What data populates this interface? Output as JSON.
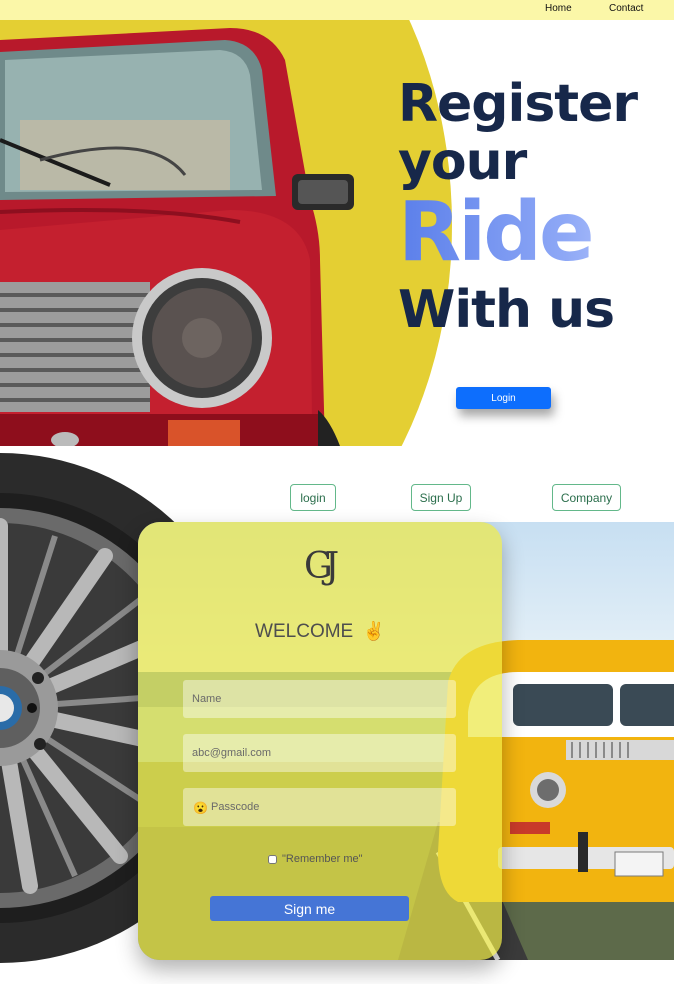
{
  "nav": {
    "home": "Home",
    "contact": "Contact"
  },
  "hero": {
    "line1": "Register",
    "line2": "your",
    "line3": "Ride",
    "line4": "With us",
    "login_button": "Login"
  },
  "tabs": {
    "login": "login",
    "signup": "Sign Up",
    "company": "Company"
  },
  "form": {
    "logo": "GJ",
    "welcome": "WELCOME",
    "welcome_icon": "✌️",
    "name_placeholder": "Name",
    "email_placeholder": "abc@gmail.com",
    "pass_icon": "😮",
    "pass_placeholder": "Passcode",
    "remember": "\"Remember me\"",
    "submit": "Sign me"
  },
  "colors": {
    "accent_blue": "#0d6efd",
    "hero_yellow": "#e4cf33",
    "topbar_yellow": "#fbf7a8",
    "title_navy": "#17284a",
    "ride_gradient_start": "#5b7fea",
    "card_tint": "#ece846"
  }
}
